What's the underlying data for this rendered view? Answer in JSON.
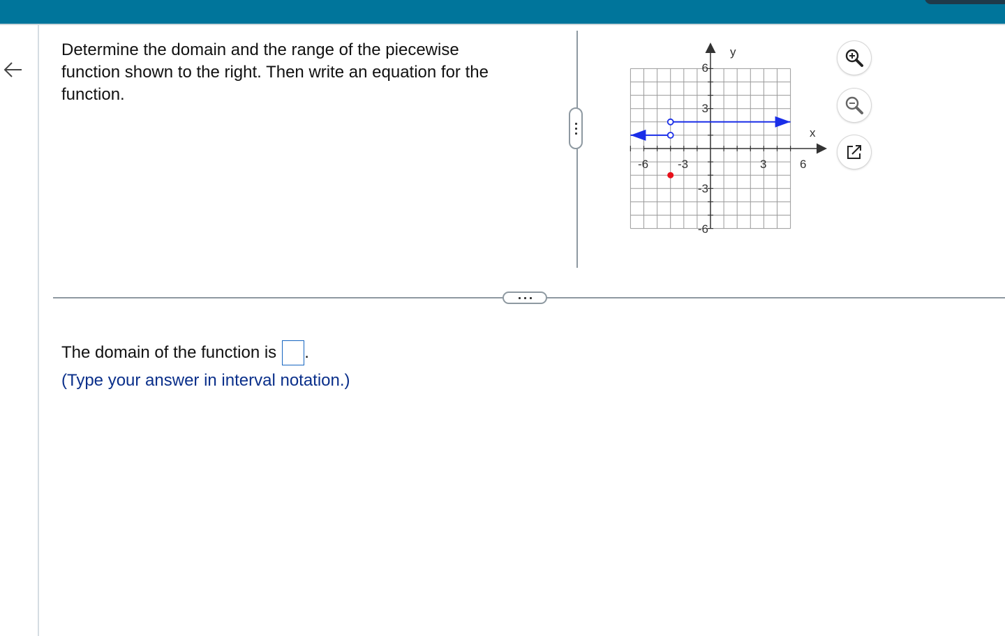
{
  "question": {
    "line1": "Determine the domain and the range of the piecewise",
    "line2": "function shown to the right. Then write an equation for the",
    "line3": "function."
  },
  "graph": {
    "y_axis_label": "y",
    "x_axis_label": "x",
    "x_tick_labels": [
      "-6",
      "-3",
      "3",
      "6"
    ],
    "y_tick_labels": [
      "6",
      "3",
      "-3",
      "-6"
    ],
    "segments": [
      {
        "from": [
          -6,
          1
        ],
        "to": [
          -3,
          1
        ],
        "arrow_left": true,
        "right_end": "open",
        "color": "#1a2ee8"
      },
      {
        "from": [
          -3,
          2
        ],
        "to": [
          6,
          2
        ],
        "arrow_right": true,
        "left_end": "open",
        "color": "#1a2ee8"
      }
    ],
    "points": [
      {
        "x": -3,
        "y": -2,
        "style": "closed",
        "color": "#e8101a"
      }
    ]
  },
  "tools": {
    "zoom_in": "zoom-in-icon",
    "zoom_out": "zoom-out-icon",
    "popout": "popout-icon"
  },
  "answer": {
    "prefix": "The domain of the function is",
    "suffix": ".",
    "hint": "(Type your answer in interval notation.)"
  },
  "colors": {
    "topbar": "#00759b",
    "curve": "#1a2ee8",
    "point": "#e8101a",
    "hint": "#0a2f8a",
    "input_border": "#1565c0"
  }
}
